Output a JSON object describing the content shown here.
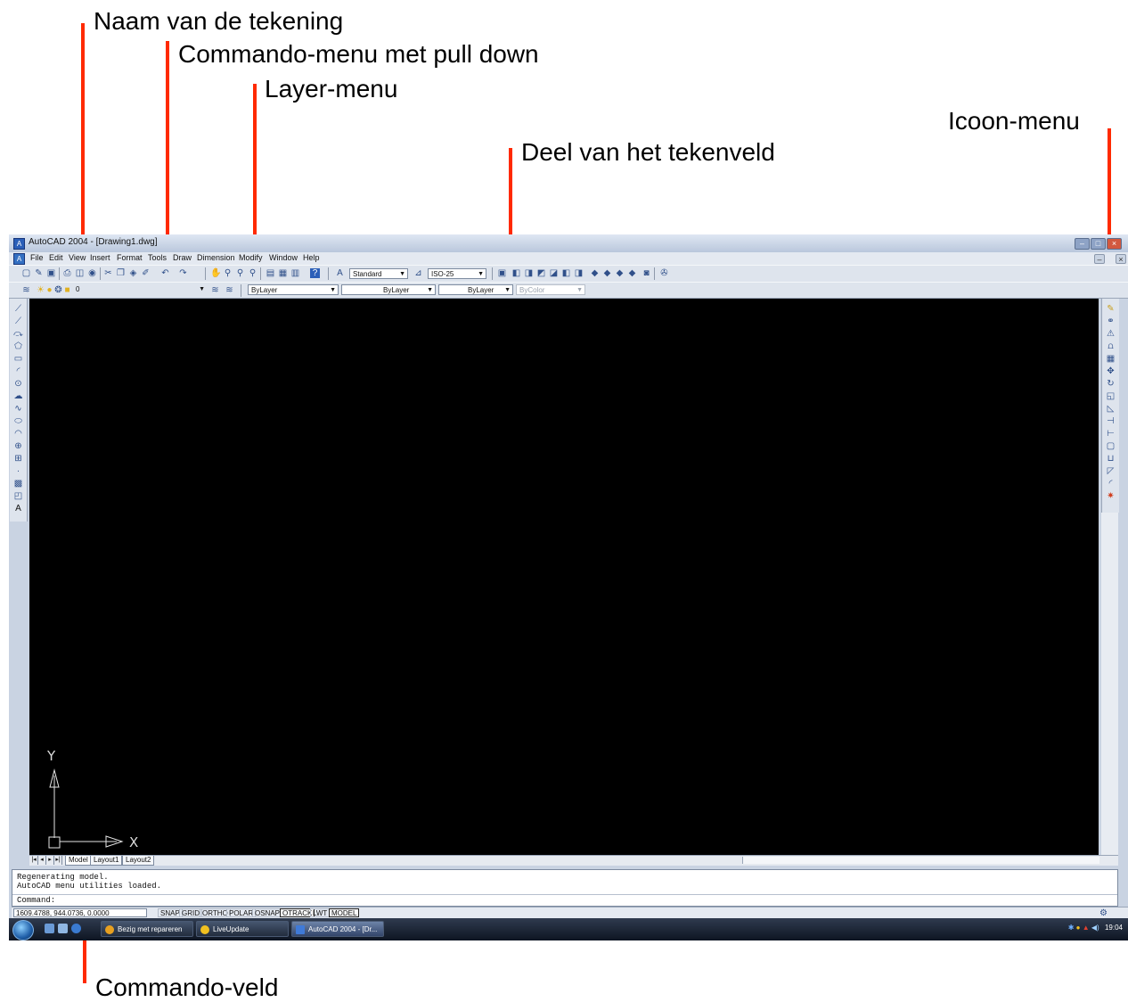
{
  "annotations": {
    "drawing_name": "Naam van de tekening",
    "command_menu": "Commando-menu met pull down",
    "layer_menu": "Layer-menu",
    "icon_menu": "Icoon-menu",
    "drawing_field": "Deel van het tekenveld",
    "command_field": "Commando-veld"
  },
  "colors": {
    "annotation_line": "#ff2a00",
    "canvas": "#000000"
  },
  "window": {
    "title": "AutoCAD 2004 - [Drawing1.dwg]"
  },
  "menu": [
    "File",
    "Edit",
    "View",
    "Insert",
    "Format",
    "Tools",
    "Draw",
    "Dimension",
    "Modify",
    "Window",
    "Help"
  ],
  "toolbar": {
    "text_style": "Standard",
    "dim_style": "ISO-25"
  },
  "layer_bar": {
    "layer": "0",
    "color": "ByLayer",
    "linetype": "ByLayer",
    "lineweight": "ByLayer",
    "plotstyle": "ByColor"
  },
  "canvas": {
    "ucs_y": "Y",
    "ucs_x": "X"
  },
  "tabs": [
    "Model",
    "Layout1",
    "Layout2"
  ],
  "command_window": {
    "lines": [
      "Regenerating model.",
      "AutoCAD menu utilities loaded."
    ],
    "prompt": "Command:"
  },
  "status": {
    "coords": "1609.4788, 944.0736, 0.0000",
    "toggles": [
      "SNAP",
      "GRID",
      "ORTHO",
      "POLAR",
      "OSNAP",
      "OTRACK",
      "LWT",
      "MODEL"
    ]
  },
  "taskbar": {
    "items": [
      "Bezig met repareren",
      "LiveUpdate",
      "AutoCAD 2004 - [Dr..."
    ],
    "clock": "19:04"
  }
}
